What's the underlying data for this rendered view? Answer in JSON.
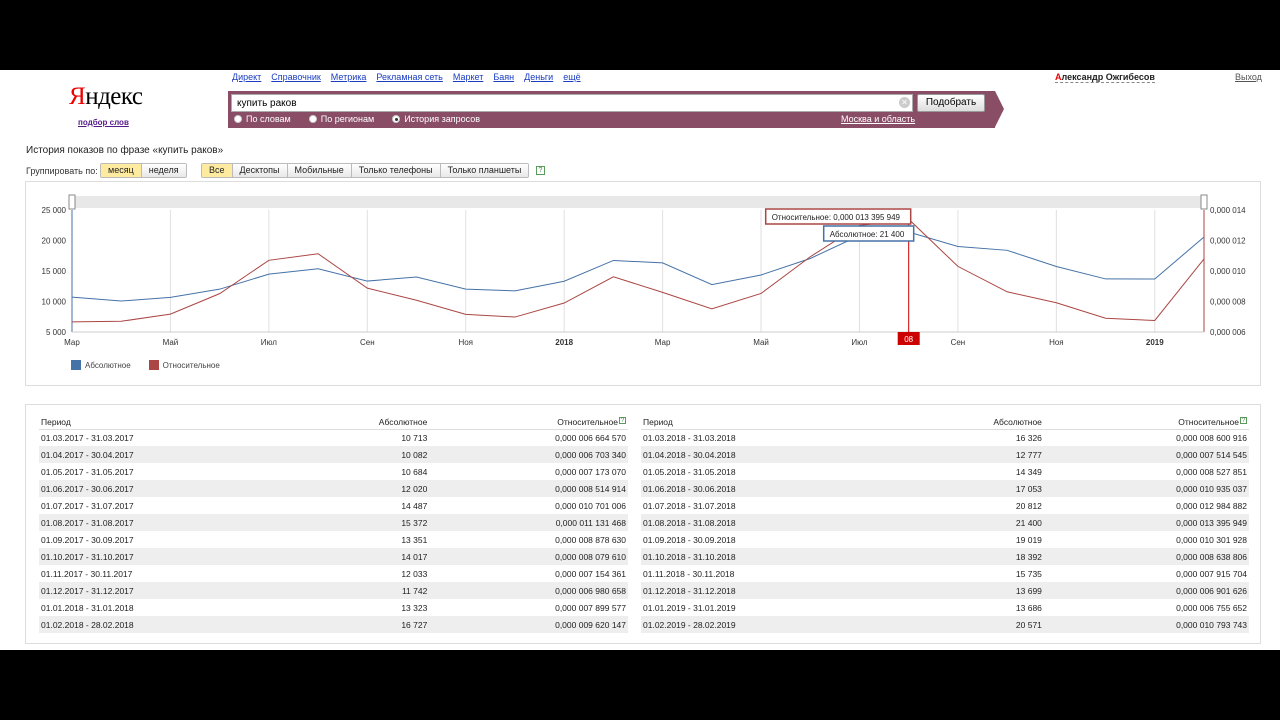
{
  "header": {
    "logo_first": "Я",
    "logo_rest": "ндекс",
    "logo_sub": "подбор слов",
    "services": [
      "Директ",
      "Справочник",
      "Метрика",
      "Рекламная сеть",
      "Маркет",
      "Баян",
      "Деньги",
      "ещё"
    ],
    "user_first": "А",
    "user_rest": "лександр Ожгибесов",
    "logout": "Выход"
  },
  "search": {
    "value": "купить раков",
    "button": "Подобрать",
    "modes": [
      "По словам",
      "По регионам",
      "История запросов"
    ],
    "selected_mode": "История запросов",
    "region": "Москва и область"
  },
  "page": {
    "title": "История показов по фразе «купить раков»",
    "group_label": "Группировать по:",
    "period_options": [
      "месяц",
      "неделя"
    ],
    "period_selected": "месяц",
    "device_options": [
      "Все",
      "Десктопы",
      "Мобильные",
      "Только телефоны",
      "Только планшеты"
    ],
    "device_selected": "Все",
    "help": "?"
  },
  "colors": {
    "absolute": "#4572a7",
    "relative": "#aa4643",
    "accent": "#8a4d66",
    "marker": "#cc0000"
  },
  "chart_data": {
    "type": "line",
    "x": [
      "2017-03",
      "2017-04",
      "2017-05",
      "2017-06",
      "2017-07",
      "2017-08",
      "2017-09",
      "2017-10",
      "2017-11",
      "2017-12",
      "2018-01",
      "2018-02",
      "2018-03",
      "2018-04",
      "2018-05",
      "2018-06",
      "2018-07",
      "2018-08",
      "2018-09",
      "2018-10",
      "2018-11",
      "2018-12",
      "2019-01",
      "2019-02"
    ],
    "x_tick_labels": [
      "Мар",
      "Май",
      "Июл",
      "Сен",
      "Ноя",
      "2018",
      "Мар",
      "Май",
      "Июл",
      "Сен",
      "Ноя",
      "2019"
    ],
    "series": [
      {
        "name": "Абсолютное",
        "axis": "left",
        "values": [
          10713,
          10082,
          10684,
          12020,
          14487,
          15372,
          13351,
          14017,
          12033,
          11742,
          13323,
          16727,
          16326,
          12777,
          14349,
          17053,
          20812,
          21400,
          19019,
          18392,
          15735,
          13699,
          13686,
          20571
        ]
      },
      {
        "name": "Относительное",
        "axis": "right",
        "values": [
          6.66457e-06,
          6.70334e-06,
          7.17307e-06,
          8.514914e-06,
          1.0701006e-05,
          1.1131468e-05,
          8.87863e-06,
          8.07961e-06,
          7.154361e-06,
          6.980658e-06,
          7.899577e-06,
          9.620147e-06,
          8.600916e-06,
          7.514545e-06,
          8.527851e-06,
          1.0935037e-05,
          1.2984882e-05,
          1.3395949e-05,
          1.0301928e-05,
          8.638806e-06,
          7.915704e-06,
          6.901626e-06,
          6.755652e-06,
          1.0793743e-05
        ]
      }
    ],
    "y_left_ticks": [
      "25 000",
      "20 000",
      "15 000",
      "10 000",
      "5 000"
    ],
    "y_left_range": [
      5000,
      25000
    ],
    "y_right_ticks": [
      "0,000 014",
      "0,000 012",
      "0,000 010",
      "0,000 008",
      "0,000 006"
    ],
    "y_right_range": [
      6e-06,
      1.4e-05
    ],
    "tooltip_relative": "Относительное: 0,000 013 395 949",
    "tooltip_absolute": "Абсолютное: 21 400",
    "marker_label": "08",
    "marker_index": 17,
    "legend": "bottom-left",
    "grid": "vertical"
  },
  "table": {
    "headers": {
      "period": "Период",
      "absolute": "Абсолютное",
      "relative": "Относительное"
    },
    "left_rows": [
      [
        "01.03.2017 - 31.03.2017",
        "10 713",
        "0,000 006 664 570"
      ],
      [
        "01.04.2017 - 30.04.2017",
        "10 082",
        "0,000 006 703 340"
      ],
      [
        "01.05.2017 - 31.05.2017",
        "10 684",
        "0,000 007 173 070"
      ],
      [
        "01.06.2017 - 30.06.2017",
        "12 020",
        "0,000 008 514 914"
      ],
      [
        "01.07.2017 - 31.07.2017",
        "14 487",
        "0,000 010 701 006"
      ],
      [
        "01.08.2017 - 31.08.2017",
        "15 372",
        "0,000 011 131 468"
      ],
      [
        "01.09.2017 - 30.09.2017",
        "13 351",
        "0,000 008 878 630"
      ],
      [
        "01.10.2017 - 31.10.2017",
        "14 017",
        "0,000 008 079 610"
      ],
      [
        "01.11.2017 - 30.11.2017",
        "12 033",
        "0,000 007 154 361"
      ],
      [
        "01.12.2017 - 31.12.2017",
        "11 742",
        "0,000 006 980 658"
      ],
      [
        "01.01.2018 - 31.01.2018",
        "13 323",
        "0,000 007 899 577"
      ],
      [
        "01.02.2018 - 28.02.2018",
        "16 727",
        "0,000 009 620 147"
      ]
    ],
    "right_rows": [
      [
        "01.03.2018 - 31.03.2018",
        "16 326",
        "0,000 008 600 916"
      ],
      [
        "01.04.2018 - 30.04.2018",
        "12 777",
        "0,000 007 514 545"
      ],
      [
        "01.05.2018 - 31.05.2018",
        "14 349",
        "0,000 008 527 851"
      ],
      [
        "01.06.2018 - 30.06.2018",
        "17 053",
        "0,000 010 935 037"
      ],
      [
        "01.07.2018 - 31.07.2018",
        "20 812",
        "0,000 012 984 882"
      ],
      [
        "01.08.2018 - 31.08.2018",
        "21 400",
        "0,000 013 395 949"
      ],
      [
        "01.09.2018 - 30.09.2018",
        "19 019",
        "0,000 010 301 928"
      ],
      [
        "01.10.2018 - 31.10.2018",
        "18 392",
        "0,000 008 638 806"
      ],
      [
        "01.11.2018 - 30.11.2018",
        "15 735",
        "0,000 007 915 704"
      ],
      [
        "01.12.2018 - 31.12.2018",
        "13 699",
        "0,000 006 901 626"
      ],
      [
        "01.01.2019 - 31.01.2019",
        "13 686",
        "0,000 006 755 652"
      ],
      [
        "01.02.2019 - 28.02.2019",
        "20 571",
        "0,000 010 793 743"
      ]
    ]
  }
}
